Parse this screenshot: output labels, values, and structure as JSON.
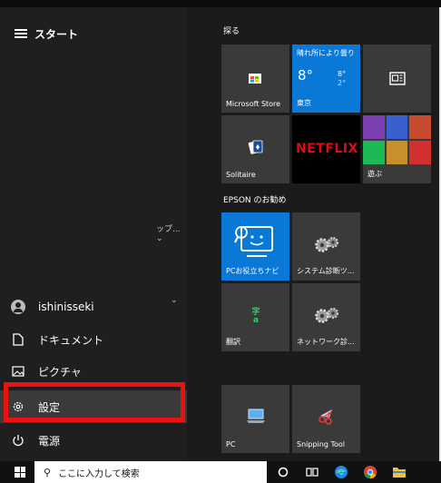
{
  "start_menu": {
    "title": "スタート",
    "user": "ishinisseki",
    "items": {
      "documents": "ドキュメント",
      "pictures": "ピクチャ",
      "settings": "設定",
      "power": "電源"
    },
    "cut_off_text": "ップ..."
  },
  "tiles": {
    "section_explore": "探る",
    "section_epson": "EPSON のお勧め",
    "weather": {
      "condition": "晴れ所により曇り",
      "temp": "8°",
      "high": "8°",
      "low": "2°",
      "city": "東京"
    },
    "labels": {
      "store": "Microsoft Store",
      "solitaire": "Solitaire",
      "netflix": "NETFLIX",
      "play": "遊ぶ",
      "pc_help": "PCお役立ちナビ",
      "sys_diag": "システム診断ツ...",
      "translate": "翻訳",
      "net_diag": "ネットワーク診...",
      "pc": "PC",
      "snipping": "Snipping Tool"
    }
  },
  "taskbar": {
    "search_placeholder": "ここに入力して検索"
  },
  "colors": {
    "highlight_box": "#ee1111",
    "tile_blue": "#0a78d7"
  }
}
